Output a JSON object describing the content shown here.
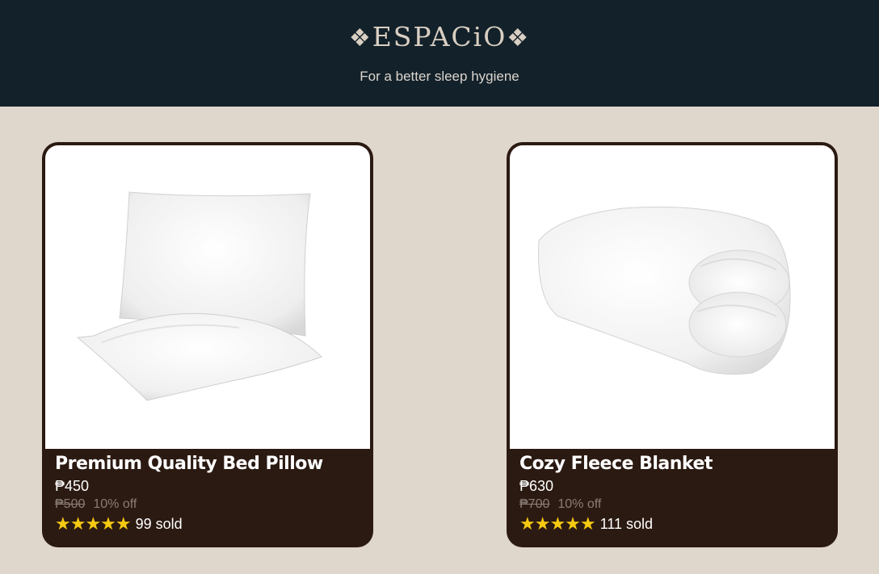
{
  "header": {
    "brand": "ESPACiO",
    "tagline": "For a better sleep hygiene"
  },
  "colors": {
    "header_bg": "#13212a",
    "page_bg": "#dfd6cc",
    "card_bg": "#2b1a12",
    "star": "#f6c912"
  },
  "products": [
    {
      "title": "Premium Quality Bed Pillow",
      "price": "₱450",
      "old_price": "₱500",
      "discount": "10% off",
      "stars": "★★★★★",
      "rating": 5,
      "sold": "99 sold",
      "image_icon": "pillow-image"
    },
    {
      "title": "Cozy Fleece Blanket",
      "price": "₱630",
      "old_price": "₱700",
      "discount": "10% off",
      "stars": "★★★★★",
      "rating": 5,
      "sold": "111 sold",
      "image_icon": "blanket-image"
    }
  ]
}
